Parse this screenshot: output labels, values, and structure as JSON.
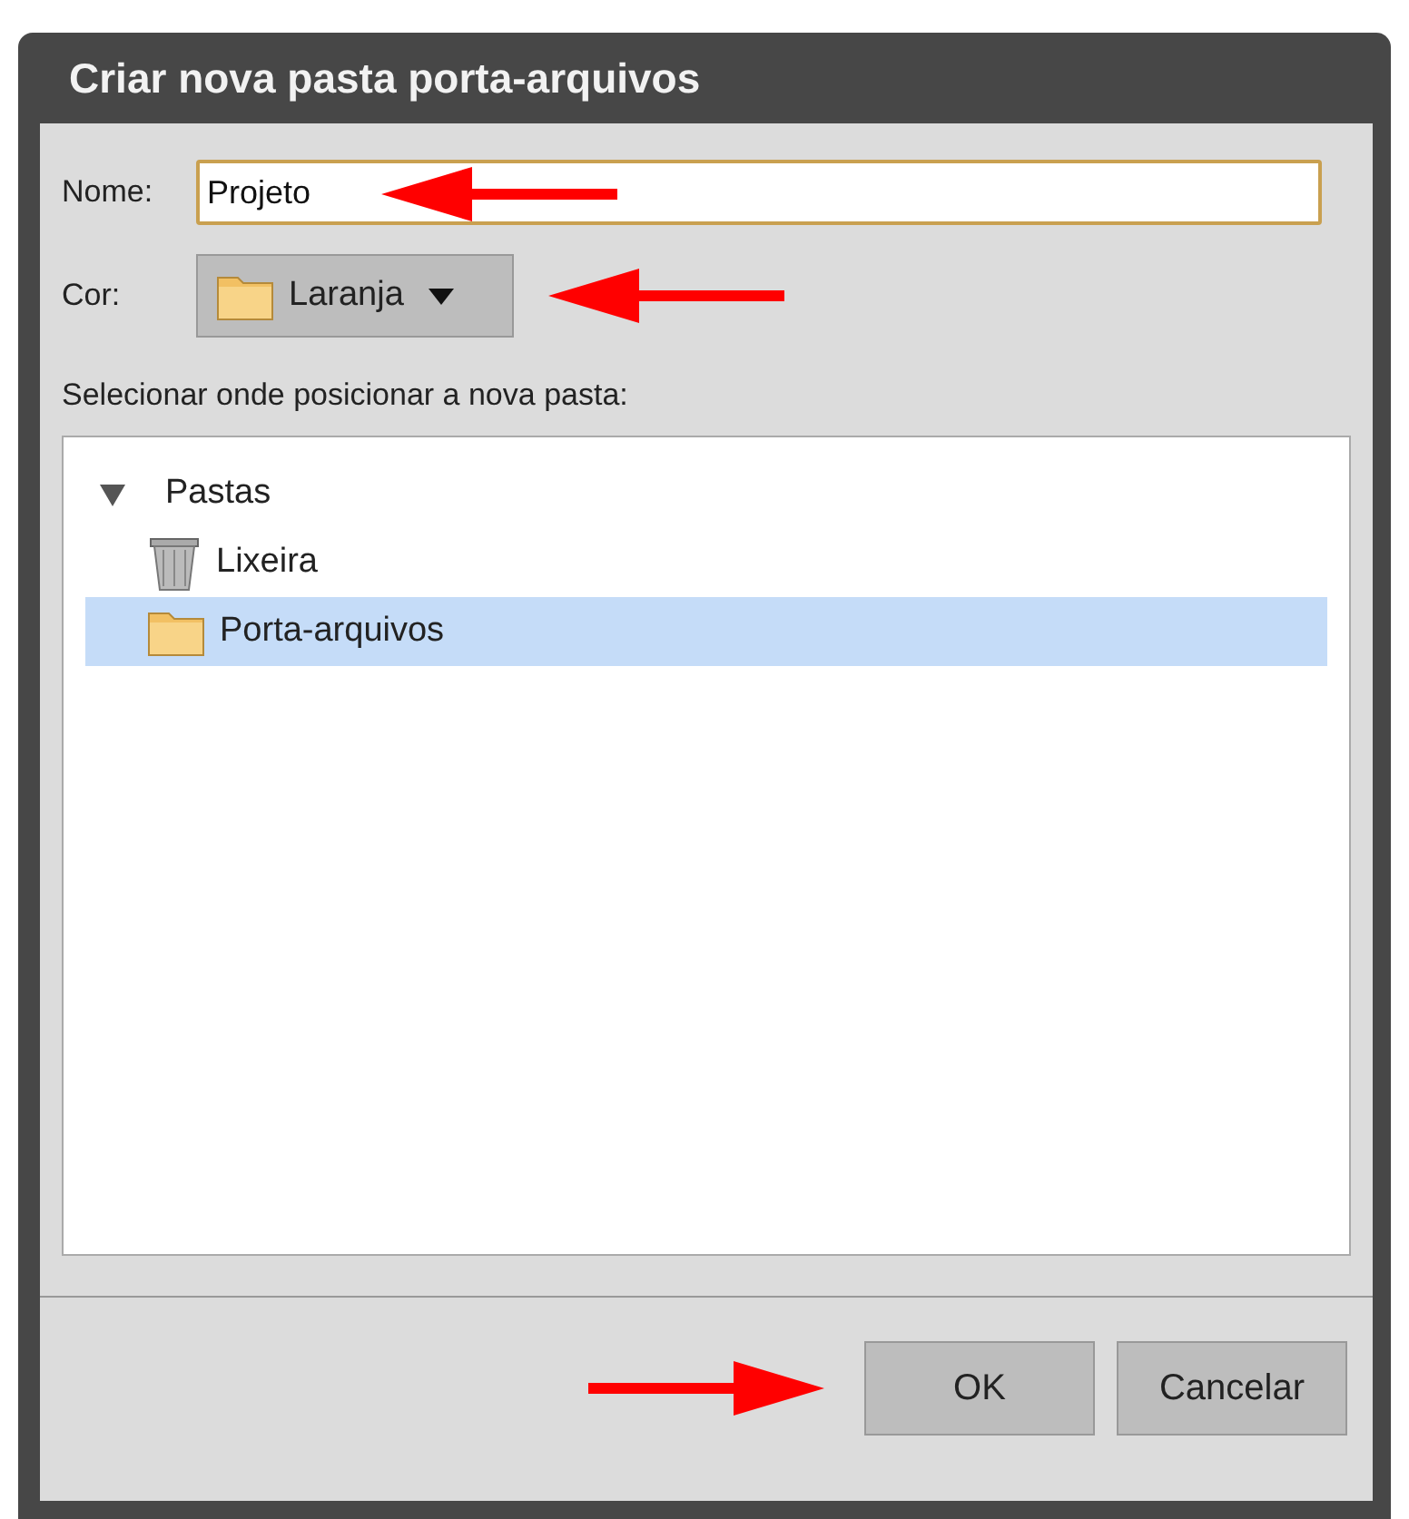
{
  "window": {
    "title": "Criar nova pasta porta-arquivos"
  },
  "name_field": {
    "label": "Nome:",
    "value": "Projeto"
  },
  "color_field": {
    "label": "Cor:",
    "value": "Laranja"
  },
  "location_label": "Selecionar onde posicionar a nova pasta:",
  "tree": [
    {
      "label": "Pastas",
      "expanded": true,
      "selected": false,
      "children": [
        {
          "label": "Lixeira",
          "kind": "trash",
          "selected": false
        },
        {
          "label": "Porta-arquivos",
          "kind": "folder",
          "selected": true
        }
      ]
    }
  ],
  "buttons": [
    {
      "label": "OK"
    },
    {
      "label": "Cancelar"
    }
  ]
}
